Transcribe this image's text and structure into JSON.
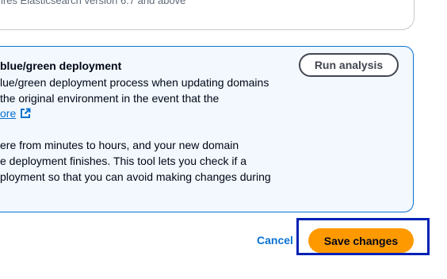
{
  "top_card": {
    "text": "ires Elasticsearch version 6.7 and above"
  },
  "info": {
    "title": "blue/green deployment",
    "para1": [
      "lue/green deployment process when updating domains",
      "the original environment in the event that the"
    ],
    "learn_more": "ore",
    "para2": [
      "ere from minutes to hours, and your new domain",
      "e deployment finishes. This tool lets you check if a",
      "ployment so that you can avoid making changes during"
    ],
    "run_button": "Run analysis"
  },
  "footer": {
    "cancel": "Cancel",
    "save": "Save changes"
  },
  "colors": {
    "accent": "#0972d3",
    "primary_button": "#ff9900",
    "highlight": "#0021b5",
    "info_background": "#f2f8fd"
  },
  "icons": {
    "external_link": "external-link-icon"
  }
}
